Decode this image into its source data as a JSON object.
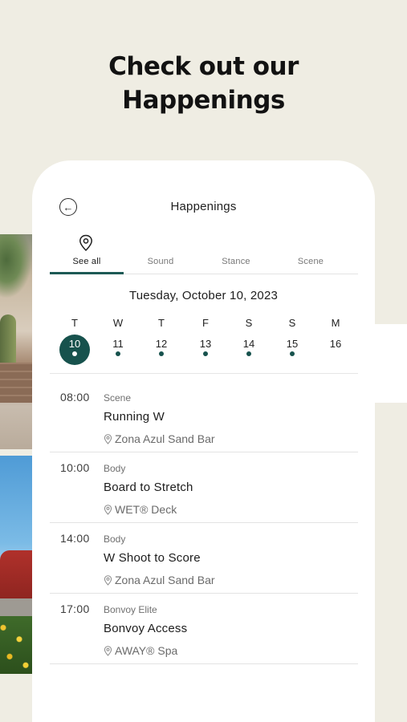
{
  "headline": [
    "Check out our",
    "Happenings"
  ],
  "header": {
    "title": "Happenings",
    "back_icon": "back-arrow-icon"
  },
  "tabs": [
    {
      "label": "See all",
      "icon": "location-pin-icon",
      "active": true
    },
    {
      "label": "Sound",
      "active": false
    },
    {
      "label": "Stance",
      "active": false
    },
    {
      "label": "Scene",
      "active": false
    }
  ],
  "date_heading": "Tuesday, October 10, 2023",
  "week": [
    {
      "dow": "T",
      "num": "10",
      "selected": true,
      "has_events": true
    },
    {
      "dow": "W",
      "num": "11",
      "selected": false,
      "has_events": true
    },
    {
      "dow": "T",
      "num": "12",
      "selected": false,
      "has_events": true
    },
    {
      "dow": "F",
      "num": "13",
      "selected": false,
      "has_events": true
    },
    {
      "dow": "S",
      "num": "14",
      "selected": false,
      "has_events": true
    },
    {
      "dow": "S",
      "num": "15",
      "selected": false,
      "has_events": true
    },
    {
      "dow": "M",
      "num": "16",
      "selected": false,
      "has_events": false
    }
  ],
  "events": [
    {
      "time": "08:00",
      "category": "Scene",
      "name": "Running W",
      "location": "Zona Azul Sand Bar"
    },
    {
      "time": "10:00",
      "category": "Body",
      "name": "Board to Stretch",
      "location": "WET® Deck"
    },
    {
      "time": "14:00",
      "category": "Body",
      "name": "W Shoot to Score",
      "location": "Zona Azul Sand Bar"
    },
    {
      "time": "17:00",
      "category": "Bonvoy Elite",
      "name": "Bonvoy Access",
      "location": "AWAY® Spa"
    }
  ],
  "colors": {
    "accent": "#17524d",
    "background": "#efede3"
  }
}
